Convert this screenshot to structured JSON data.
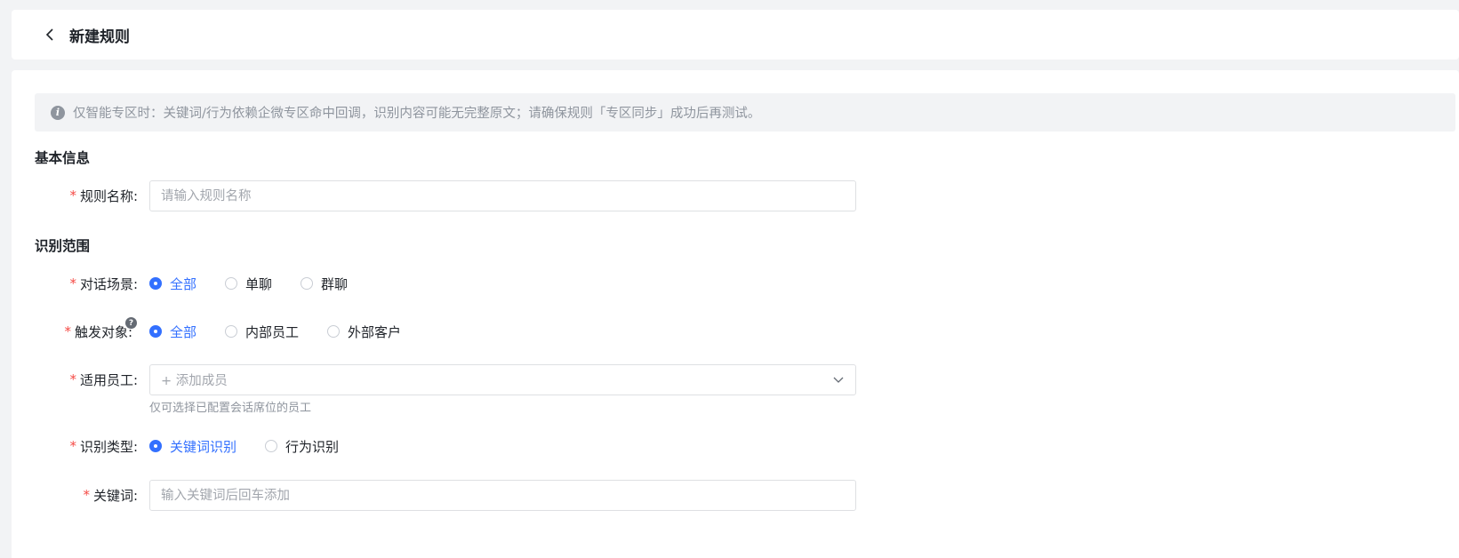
{
  "header": {
    "title": "新建规则"
  },
  "notice": {
    "text": "仅智能专区时：关键词/行为依赖企微专区命中回调，识别内容可能无完整原文；请确保规则「专区同步」成功后再测试。"
  },
  "sections": {
    "basic": "基本信息",
    "scope": "识别范围"
  },
  "form": {
    "rule_name": {
      "label": "规则名称:",
      "placeholder": "请输入规则名称",
      "value": ""
    },
    "scene": {
      "label": "对话场景:",
      "options": [
        "全部",
        "单聊",
        "群聊"
      ],
      "selected": "全部"
    },
    "target": {
      "label": "触发对象:",
      "options": [
        "全部",
        "内部员工",
        "外部客户"
      ],
      "selected": "全部",
      "help_icon": "question-icon"
    },
    "staff": {
      "label": "适用员工:",
      "placeholder": "+ 添加成员",
      "hint": "仅可选择已配置会话席位的员工"
    },
    "type": {
      "label": "识别类型:",
      "options": [
        "关键词识别",
        "行为识别"
      ],
      "selected": "关键词识别"
    },
    "keyword": {
      "label": "关键词:",
      "placeholder": "输入关键词后回车添加",
      "value": ""
    }
  },
  "colors": {
    "accent": "#3370ff",
    "required": "#f54a45"
  }
}
